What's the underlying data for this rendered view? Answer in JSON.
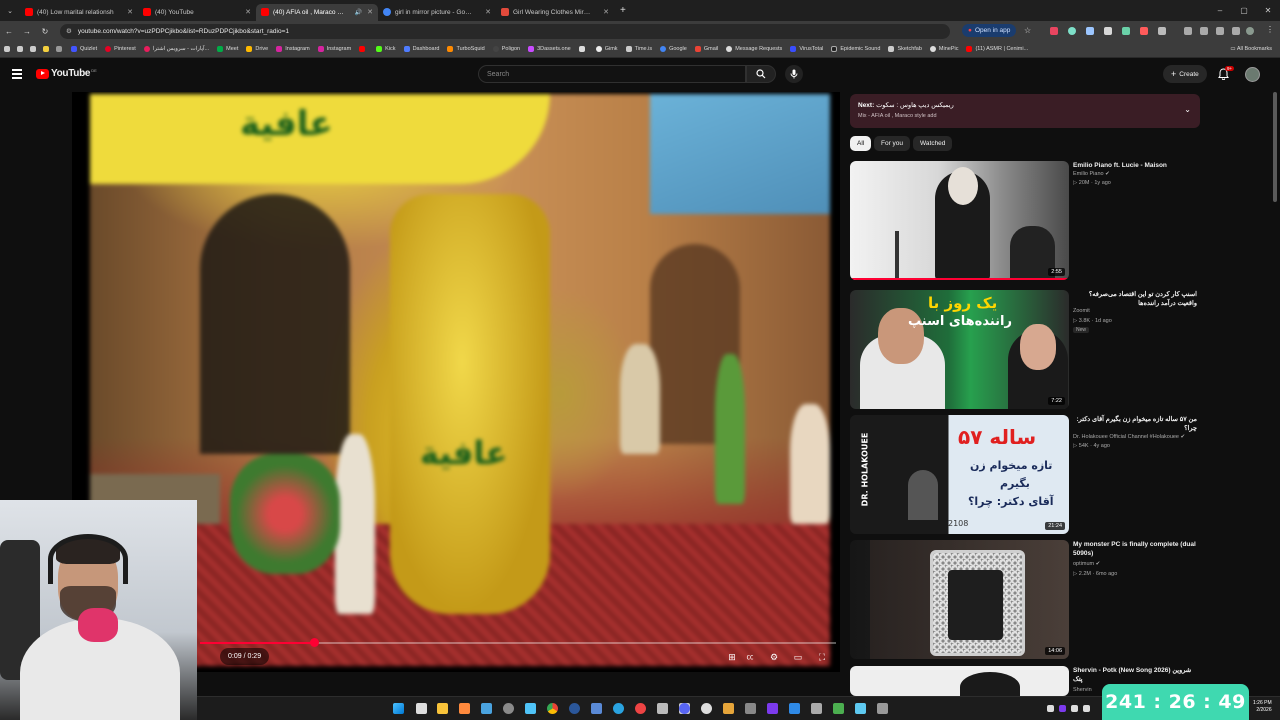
{
  "browser": {
    "tabs": [
      {
        "title": "(40) Low marital relationsh",
        "color": "#ff0000",
        "active": false
      },
      {
        "title": "(40) YouTube",
        "color": "#ff0000",
        "active": false
      },
      {
        "title": "(40) AFIA oil , Maraco style",
        "color": "#ff0000",
        "active": true
      },
      {
        "title": "girl in mirror picture - Google S",
        "color": "#4285f4",
        "active": false
      },
      {
        "title": "Girl Wearing Clothes Mirror Sel",
        "color": "#e24a3b",
        "active": false
      }
    ],
    "new_tab": "+",
    "url": "youtube.com/watch?v=uzPDPCjikbo&list=RDuzPDPCjikbo&start_radio=1",
    "open_in_app": "Open in app",
    "bookmarks": [
      "Quizlet",
      "Pinterest",
      "آپارات - سرویس اشترا...",
      "Meet",
      "Drive",
      "Instagram",
      "Instagram",
      "",
      "Kick",
      "Dashboard",
      "TurboSquid",
      "Poligon",
      "3Dassets.one",
      "",
      "Gimk",
      "Time.is",
      "Google",
      "Gmail",
      "Message Requests",
      "VirusTotal",
      "Epidemic Sound",
      "Sketchfab",
      "MinePic",
      "(11) ASMR | Cenimi..."
    ],
    "all_bookmarks": "All Bookmarks"
  },
  "youtube": {
    "logo": "YouTube",
    "logo_region": "DE",
    "search_placeholder": "Search",
    "create": "Create",
    "notif_badge": "9+",
    "player": {
      "time": "0:09 / 0:29",
      "progress_fraction": 0.18
    },
    "next": {
      "label": "Next:",
      "title": "ریمیکس دیپ هاوس : سکوت",
      "subtitle": "Mix - AFIA oil , Maraco style add"
    },
    "chips": [
      "All",
      "For you",
      "Watched"
    ],
    "videos": [
      {
        "title": "Emilio Piano ft. Lucie - Maison",
        "channel": "Emilio Piano",
        "meta": "20M · 1y ago",
        "duration": "2:55",
        "badge": ""
      },
      {
        "title": "اسنپ کار کردن تو این اقتصاد می‌صرفه؟ واقعیت درآمد راننده‌ها",
        "channel": "Zoomit",
        "meta": "3.8K · 1d ago",
        "duration": "7:22",
        "badge": "New"
      },
      {
        "title": "من ۵۷ ساله تازه میخوام زن بگیرم آقای دکتر: چرا؟",
        "channel": "Dr. Holakouee Official Channel #Holakouee",
        "meta": "54K · 4y ago",
        "duration": "21:24",
        "badge": ""
      },
      {
        "title": "My monster PC is finally complete (dual 5090s)",
        "channel": "optimum",
        "meta": "2.2M · 6mo ago",
        "duration": "14:06",
        "badge": ""
      },
      {
        "title": "Shervin - Potk (New Song 2026) شروین پتک",
        "channel": "Shervin",
        "meta": "",
        "duration": "",
        "badge": ""
      }
    ],
    "thumb_texts": {
      "v2_line1": "یک روز با",
      "v2_line2": "راننده‌های اسنپ",
      "v3_big": "۵۷ ساله",
      "v3_line1": "تازه میخوام زن",
      "v3_line2": "بگیرم",
      "v3_line3": "آقای دکتر: چرا؟",
      "v3_side": "DR. HOLAKOUEE",
      "v3_num": "2108"
    },
    "video_overlay_text": "عافية"
  },
  "timer": "241 : 26 : 49",
  "clock": {
    "time": "1:26 PM",
    "date": "2/2026"
  }
}
